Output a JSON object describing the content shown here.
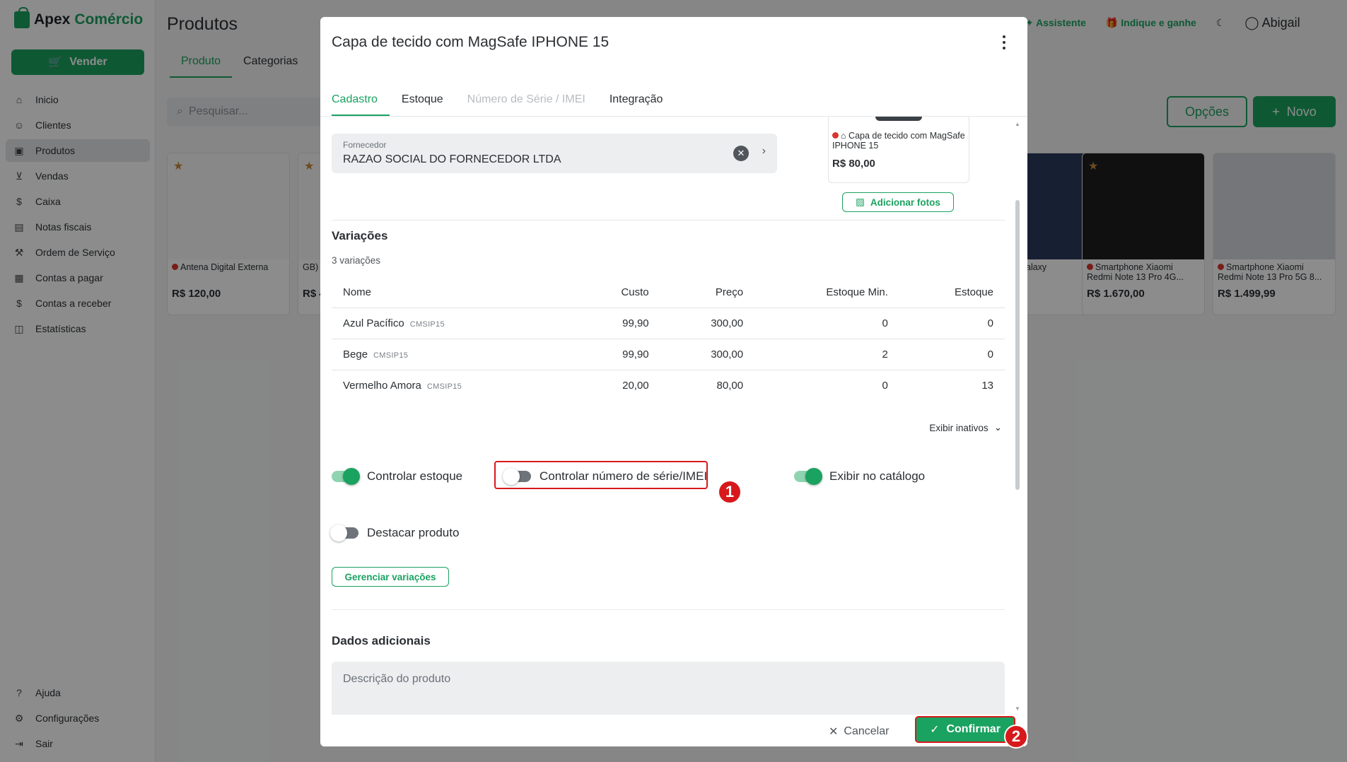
{
  "app": {
    "brand_a": "Apex",
    "brand_b": "Comércio",
    "sell_button": "Vender",
    "page_title": "Produtos",
    "tabs": [
      "Produto",
      "Categorias"
    ],
    "search_placeholder": "Pesquisar...",
    "top_links": {
      "assistant": "Assistente",
      "refer": "Indique e ganhe",
      "user": "Abigail"
    },
    "options_button": "Opções",
    "new_button": "Novo"
  },
  "sidebar": {
    "items": [
      {
        "label": "Inicio",
        "icon": "home-icon"
      },
      {
        "label": "Clientes",
        "icon": "users-icon"
      },
      {
        "label": "Produtos",
        "icon": "box-icon"
      },
      {
        "label": "Vendas",
        "icon": "cart-icon"
      },
      {
        "label": "Caixa",
        "icon": "dollar-icon"
      },
      {
        "label": "Notas fiscais",
        "icon": "receipt-icon"
      },
      {
        "label": "Ordem de Serviço",
        "icon": "wrench-icon"
      },
      {
        "label": "Contas a pagar",
        "icon": "bill-icon"
      },
      {
        "label": "Contas a receber",
        "icon": "receive-icon"
      },
      {
        "label": "Estatísticas",
        "icon": "chart-icon"
      }
    ],
    "bottom": [
      {
        "label": "Ajuda",
        "icon": "help-icon"
      },
      {
        "label": "Configurações",
        "icon": "gear-icon"
      },
      {
        "label": "Sair",
        "icon": "logout-icon"
      }
    ]
  },
  "products": [
    {
      "name": "Antena Digital Externa",
      "price": "R$ 120,00"
    },
    {
      "name": "GB)",
      "price": "R$ 4"
    },
    {
      "name": "alaxy",
      "price": ""
    },
    {
      "name": "Smartphone Xiaomi Redmi Note 13 Pro 4G...",
      "price": "R$ 1.670,00"
    },
    {
      "name": "Smartphone Xiaomi Redmi Note 13 Pro 5G 8...",
      "price": "R$ 1.499,99"
    }
  ],
  "modal": {
    "title": "Capa de tecido com MagSafe IPHONE 15",
    "tabs": {
      "cadastro": "Cadastro",
      "estoque": "Estoque",
      "serial": "Número de Série / IMEI",
      "integracao": "Integração"
    },
    "supplier": {
      "label": "Fornecedor",
      "value": "RAZAO SOCIAL DO FORNECEDOR LTDA"
    },
    "preview": {
      "name": "Capa de tecido com MagSafe IPHONE 15",
      "price": "R$ 80,00"
    },
    "add_photos": "Adicionar fotos",
    "variations": {
      "title": "Variações",
      "count": "3 variações",
      "headers": {
        "name": "Nome",
        "cost": "Custo",
        "price": "Preço",
        "min": "Estoque Min.",
        "stock": "Estoque"
      },
      "rows": [
        {
          "name": "Azul Pacífico",
          "sku": "CMSIP15",
          "cost": "99,90",
          "price": "300,00",
          "min": "0",
          "stock": "0"
        },
        {
          "name": "Bege",
          "sku": "CMSIP15",
          "cost": "99,90",
          "price": "300,00",
          "min": "2",
          "stock": "0"
        },
        {
          "name": "Vermelho Amora",
          "sku": "CMSIP15",
          "cost": "20,00",
          "price": "80,00",
          "min": "0",
          "stock": "13"
        }
      ],
      "show_inactive": "Exibir inativos"
    },
    "toggles": {
      "control_stock": {
        "label": "Controlar estoque",
        "on": true
      },
      "control_serial": {
        "label": "Controlar número de série/IMEI",
        "on": false
      },
      "show_catalog": {
        "label": "Exibir no catálogo",
        "on": true
      },
      "highlight": {
        "label": "Destacar produto",
        "on": false
      }
    },
    "manage_variations": "Gerenciar variações",
    "additional": {
      "title": "Dados adicionais",
      "description_placeholder": "Descrição do produto"
    },
    "footer": {
      "cancel": "Cancelar",
      "confirm": "Confirmar"
    }
  },
  "markers": [
    "1",
    "2"
  ],
  "colors": {
    "accent": "#1aa260",
    "danger": "#d7191c"
  }
}
